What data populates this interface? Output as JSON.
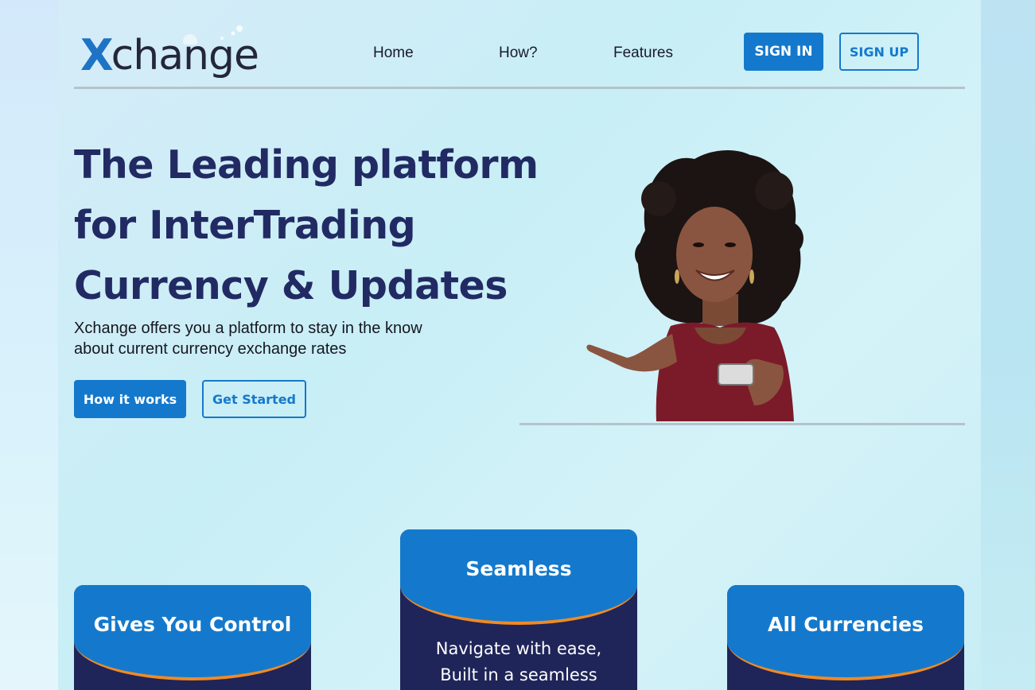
{
  "header": {
    "logo": {
      "mark": "X",
      "text": "change"
    },
    "nav": [
      {
        "label": "Home"
      },
      {
        "label": "How?"
      },
      {
        "label": "Features"
      }
    ],
    "sign_in_label": "SIGN IN",
    "sign_up_label": "SIGN UP"
  },
  "hero": {
    "title_lines": [
      "The Leading platform",
      "for InterTrading",
      "Currency & Updates"
    ],
    "subtitle_lines": [
      "Xchange offers you a platform to stay in the know",
      "about current currency exchange rates"
    ],
    "how_button_label": "How it works",
    "start_button_label": "Get Started"
  },
  "features": [
    {
      "title": "Gives You Control",
      "body": ""
    },
    {
      "title": "Seamless",
      "body_lines": [
        "Navigate with ease,",
        "Built in a seamless"
      ]
    },
    {
      "title": "All Currencies",
      "body": ""
    }
  ],
  "colors": {
    "primary": "#1479cc",
    "navy": "#222a63",
    "accent": "#f08a25"
  }
}
